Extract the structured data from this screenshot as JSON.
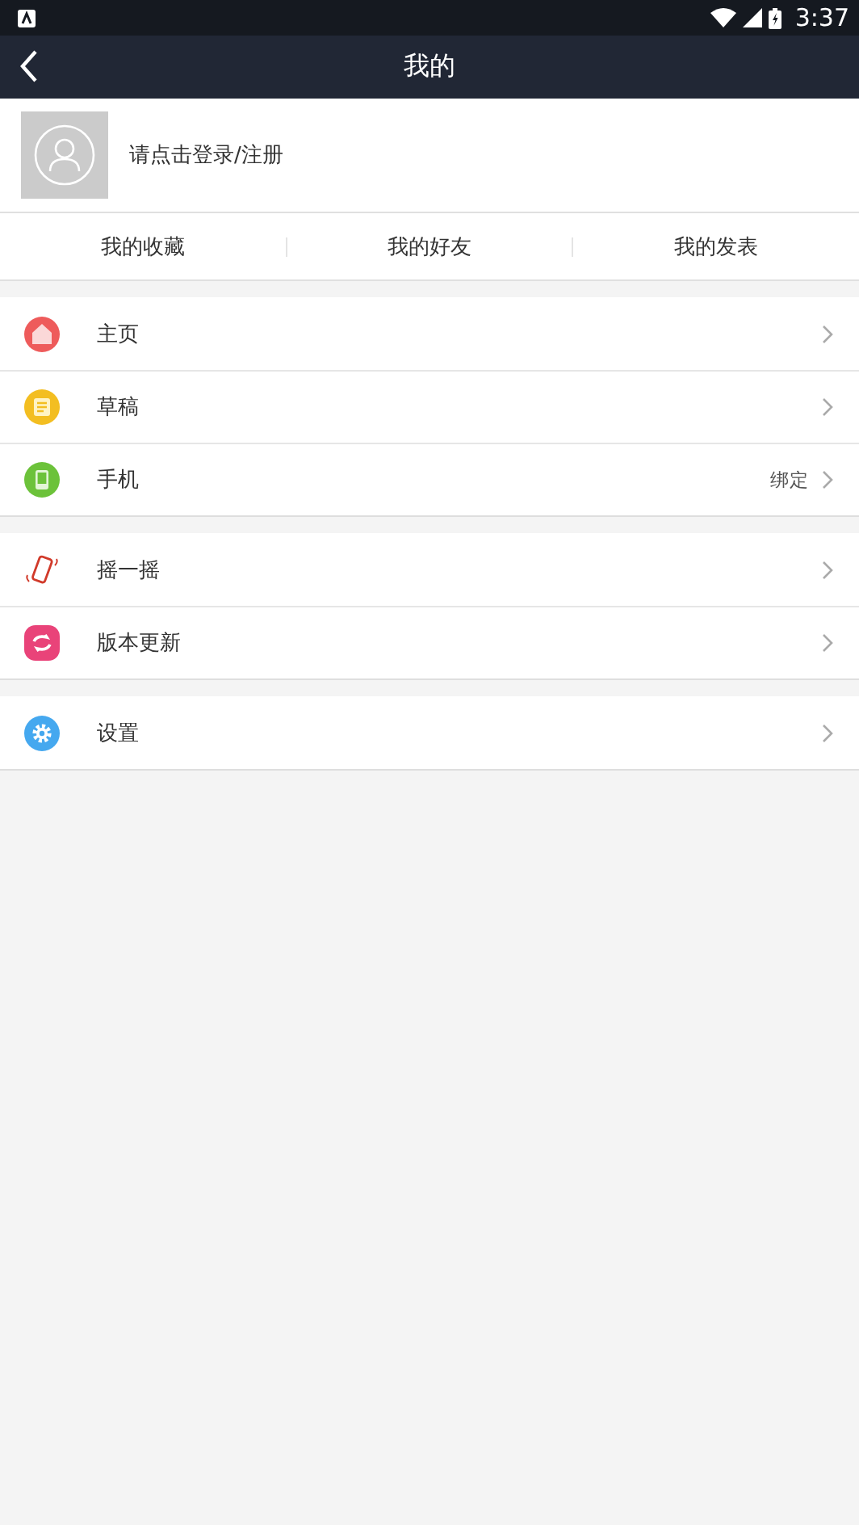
{
  "status_bar": {
    "time": "3:37"
  },
  "nav": {
    "title": "我的"
  },
  "profile": {
    "prompt": "请点击登录/注册"
  },
  "tabs": [
    {
      "label": "我的收藏"
    },
    {
      "label": "我的好友"
    },
    {
      "label": "我的发表"
    }
  ],
  "menu_groups": [
    [
      {
        "label": "主页",
        "kind": "home"
      },
      {
        "label": "草稿",
        "kind": "draft"
      },
      {
        "label": "手机",
        "kind": "phone",
        "value": "绑定"
      }
    ],
    [
      {
        "label": "摇一摇",
        "kind": "shake"
      },
      {
        "label": "版本更新",
        "kind": "update"
      }
    ],
    [
      {
        "label": "设置",
        "kind": "settings"
      }
    ]
  ]
}
